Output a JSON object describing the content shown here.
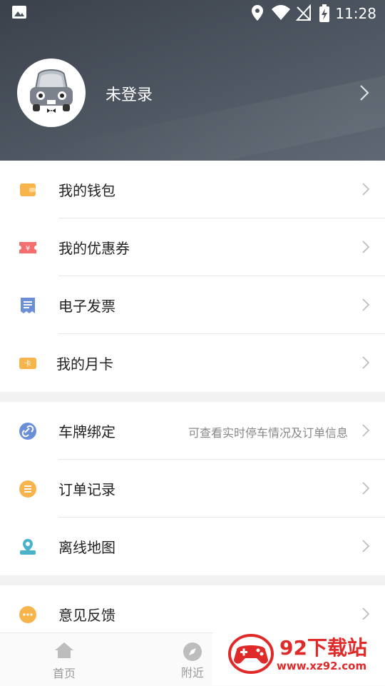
{
  "statusbar": {
    "time": "11:28"
  },
  "profile": {
    "login_label": "未登录"
  },
  "section1": [
    {
      "label": "我的钱包",
      "icon": "wallet-icon",
      "color": "#f7b44b"
    },
    {
      "label": "我的优惠券",
      "icon": "coupon-icon",
      "color": "#f36f6f"
    },
    {
      "label": "电子发票",
      "icon": "invoice-icon",
      "color": "#6b8fd6"
    },
    {
      "label": "我的月卡",
      "icon": "monthly-card-icon",
      "color": "#f7b44b"
    }
  ],
  "section2": [
    {
      "label": "车牌绑定",
      "hint": "可查看实时停车情况及订单信息",
      "icon": "link-icon",
      "color": "#6b8fd6"
    },
    {
      "label": "订单记录",
      "icon": "order-list-icon",
      "color": "#f7b44b"
    },
    {
      "label": "离线地图",
      "icon": "map-pin-icon",
      "color": "#4ab3c9"
    }
  ],
  "section3": [
    {
      "label": "意见反馈",
      "icon": "feedback-icon",
      "color": "#f7b44b"
    }
  ],
  "tabs": [
    {
      "label": "首页",
      "icon": "home-icon"
    },
    {
      "label": "附近",
      "icon": "compass-icon"
    }
  ],
  "watermark": {
    "title": "92下载站",
    "url": "www.xz92.com"
  }
}
